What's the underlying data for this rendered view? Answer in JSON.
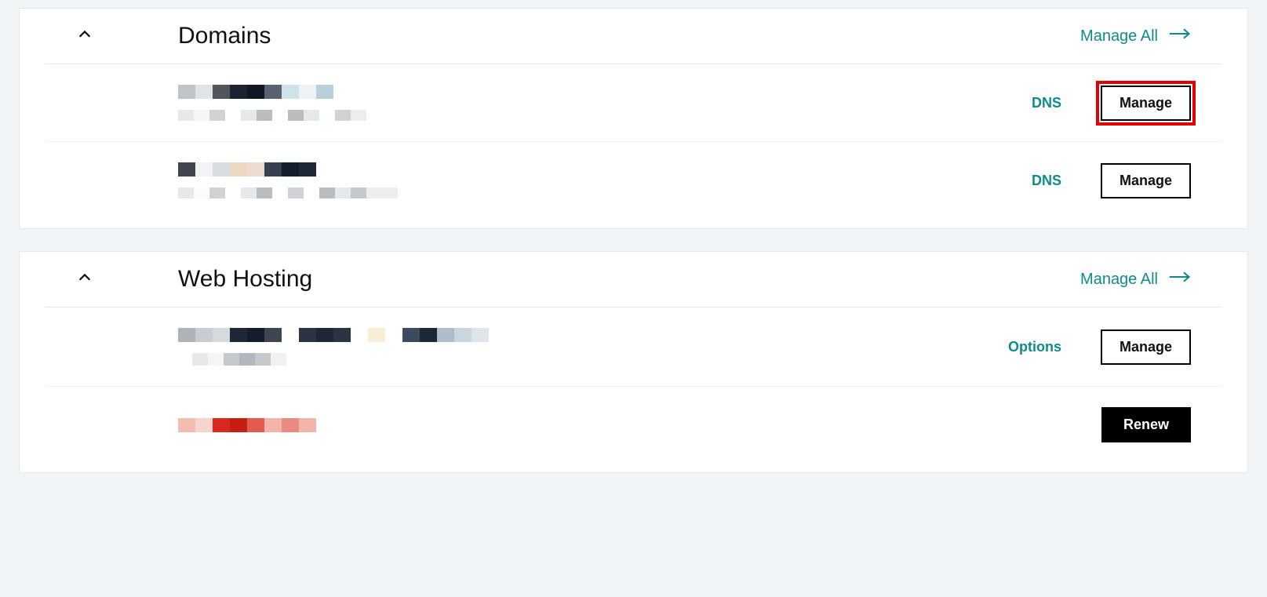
{
  "sections": {
    "domains": {
      "title": "Domains",
      "manage_all_label": "Manage All",
      "items": [
        {
          "dns_label": "DNS",
          "manage_label": "Manage",
          "highlighted": true
        },
        {
          "dns_label": "DNS",
          "manage_label": "Manage",
          "highlighted": false
        }
      ]
    },
    "web_hosting": {
      "title": "Web Hosting",
      "manage_all_label": "Manage All",
      "items": [
        {
          "options_label": "Options",
          "manage_label": "Manage"
        },
        {
          "renew_label": "Renew"
        }
      ]
    }
  },
  "colors": {
    "accent": "#0f8a8c",
    "highlight": "#e40000"
  }
}
